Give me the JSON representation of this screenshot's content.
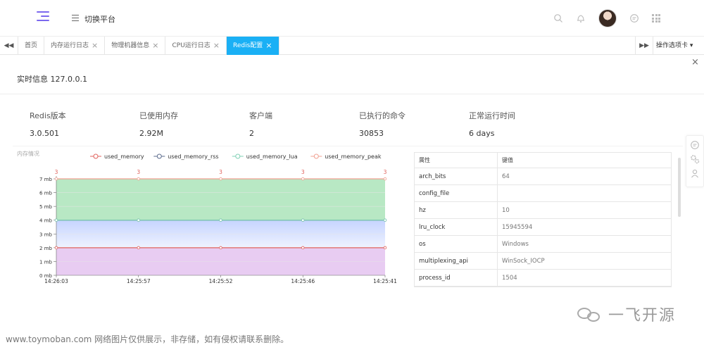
{
  "header": {
    "switch_label": "切换平台",
    "icons": [
      "search-icon",
      "bell-icon",
      "avatar",
      "chat-icon",
      "apps-grid-icon"
    ]
  },
  "tabs": {
    "items": [
      {
        "label": "首页",
        "closable": false,
        "active": false
      },
      {
        "label": "内存运行日志",
        "closable": true,
        "active": false
      },
      {
        "label": "物理机器信息",
        "closable": true,
        "active": false
      },
      {
        "label": "CPU运行日志",
        "closable": true,
        "active": false
      },
      {
        "label": "Redis配置",
        "closable": true,
        "active": true
      }
    ],
    "ops_label": "操作选项卡 ▾",
    "close_symbol": "×"
  },
  "panel": {
    "title": "实时信息 127.0.0.1"
  },
  "stats": [
    {
      "label": "Redis版本",
      "value": "3.0.501"
    },
    {
      "label": "已使用内存",
      "value": "2.92M"
    },
    {
      "label": "客户端",
      "value": "2"
    },
    {
      "label": "已执行的命令",
      "value": "30853"
    },
    {
      "label": "正常运行时间",
      "value": "6 days"
    }
  ],
  "chart_data": {
    "type": "area",
    "title": "内存情况",
    "x": [
      "14:26:03",
      "14:25:57",
      "14:25:52",
      "14:25:46",
      "14:25:41"
    ],
    "y_ticks": [
      "0 mb",
      "1 mb",
      "2 mb",
      "3 mb",
      "4 mb",
      "5 mb",
      "6 mb",
      "7 mb"
    ],
    "ylim": [
      0,
      7
    ],
    "top_labels": [
      "3",
      "3",
      "3",
      "3",
      "3"
    ],
    "legend_position": "top",
    "series": [
      {
        "name": "used_memory",
        "values": [
          2,
          2,
          2,
          2,
          2
        ],
        "color": "#e0625c"
      },
      {
        "name": "used_memory_rss",
        "values": [
          4,
          4,
          4,
          4,
          4
        ],
        "color": "#5b6b8c"
      },
      {
        "name": "used_memory_lua",
        "values": [
          4,
          4,
          4,
          4,
          4
        ],
        "color": "#7fd0b4"
      },
      {
        "name": "used_memory_peak",
        "values": [
          7,
          7,
          7,
          7,
          7
        ],
        "color": "#f0a090"
      }
    ]
  },
  "kv_table": {
    "headers": [
      "属性",
      "键值"
    ],
    "rows": [
      {
        "k": "arch_bits",
        "v": "64"
      },
      {
        "k": "config_file",
        "v": ""
      },
      {
        "k": "hz",
        "v": "10"
      },
      {
        "k": "lru_clock",
        "v": "15945594"
      },
      {
        "k": "os",
        "v": "Windows"
      },
      {
        "k": "multiplexing_api",
        "v": "WinSock_IOCP"
      },
      {
        "k": "process_id",
        "v": "1504"
      }
    ]
  },
  "watermark": "www.toymoban.com 网络图片仅供展示，非存储，如有侵权请联系删除。",
  "brand": "一飞开源",
  "colors": {
    "accent": "#1ab0f5",
    "menu": "#7b68ee"
  }
}
